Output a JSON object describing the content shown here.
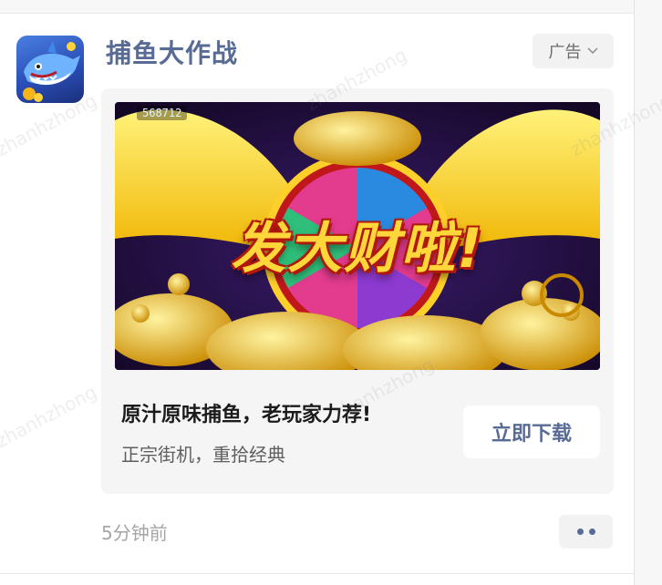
{
  "post": {
    "title": "捕鱼大作战",
    "ad_label": "广告",
    "banner": {
      "headline": "发大财啦!",
      "score": "568712"
    },
    "headline": "原汁原味捕鱼，老玩家力荐!",
    "subline": "正宗街机，重拾经典",
    "download_label": "立即下载",
    "time": "5分钟前"
  },
  "watermark": "zhanhzhong",
  "colors": {
    "link_blue": "#576b95",
    "card_bg": "#f5f5f6",
    "gold": "#ffd73a"
  },
  "icons": {
    "ad_dropdown": "chevron-down-icon",
    "more": "more-dots-icon",
    "avatar": "shark-game-icon"
  }
}
